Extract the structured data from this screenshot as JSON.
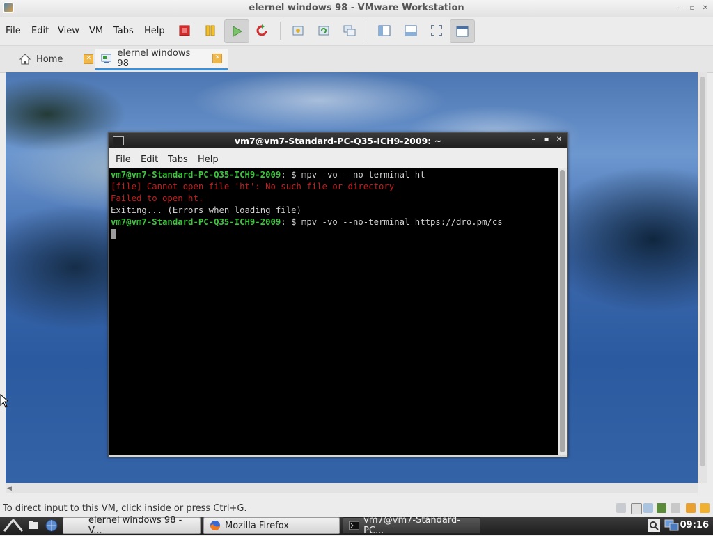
{
  "window": {
    "title": "elernel windows 98 - VMware Workstation",
    "controls": {
      "minimize": "–",
      "maximize": "▫",
      "close": "✕"
    }
  },
  "menubar": {
    "items": [
      "File",
      "Edit",
      "View",
      "VM",
      "Tabs",
      "Help"
    ]
  },
  "toolbar": {
    "buttons": [
      "power-off-icon",
      "suspend-icon",
      "power-on-icon",
      "reset-icon",
      "snapshot-icon",
      "revert-snapshot-icon",
      "snapshot-manager-icon",
      "show-sidebar-icon",
      "show-console-icon",
      "full-screen-icon",
      "unity-view-icon"
    ]
  },
  "tabs": [
    {
      "label": "Home",
      "icon": "home-icon"
    },
    {
      "label": "elernel windows 98",
      "icon": "vm-icon",
      "active": true
    }
  ],
  "terminal": {
    "title": "vm7@vm7-Standard-PC-Q35-ICH9-2009: ~",
    "menu": [
      "File",
      "Edit",
      "Tabs",
      "Help"
    ],
    "lines": [
      {
        "prompt": "vm7@vm7-Standard-PC-Q35-ICH9-2009",
        "sep": ":",
        "cmd": " $ mpv -vo --no-terminal ht"
      },
      {
        "error": "[file] Cannot open file 'ht': No such file or directory"
      },
      {
        "error": "Failed to open ht."
      },
      {
        "text": "Exiting... (Errors when loading file)"
      },
      {
        "prompt": "vm7@vm7-Standard-PC-Q35-ICH9-2009",
        "sep": ":",
        "cmd": " $ mpv -vo --no-terminal https://dro.pm/cs"
      }
    ]
  },
  "statusbar": {
    "text": "To direct input to this VM, click inside or press Ctrl+G."
  },
  "taskbar": {
    "buttons": [
      {
        "label": "elernel windows 98 - V...",
        "icon": "vmware-icon"
      },
      {
        "label": "Mozilla Firefox",
        "icon": "firefox-icon"
      },
      {
        "label": "vm7@vm7-Standard-PC...",
        "icon": "terminal-icon"
      }
    ],
    "clock": "09:16"
  },
  "colors": {
    "prompt": "#3cc43c",
    "error": "#c41c1c",
    "terminal_bg": "#000000",
    "tab_accent": "#3d8fd8"
  }
}
